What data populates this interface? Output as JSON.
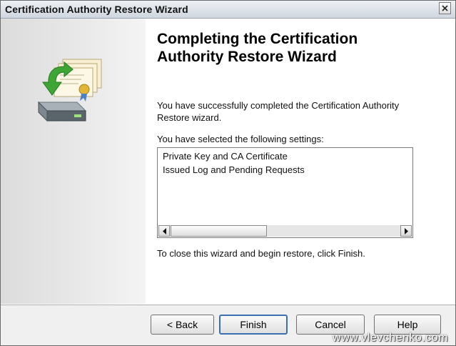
{
  "window": {
    "title": "Certification Authority Restore Wizard"
  },
  "main": {
    "heading_line1": "Completing the Certification",
    "heading_line2": "Authority Restore Wizard",
    "paragraph1": "You have successfully completed the Certification Authority Restore wizard.",
    "settings_label": "You have selected the following settings:",
    "settings": [
      "Private Key and CA Certificate",
      "Issued Log and Pending Requests"
    ],
    "instruction": "To close this wizard and begin restore, click Finish."
  },
  "buttons": {
    "back": "< Back",
    "finish": "Finish",
    "cancel": "Cancel",
    "help": "Help"
  },
  "watermark": "www.vlevchenko.com",
  "icons": [
    "close-icon",
    "certificate-restore-icon",
    "scroll-left-icon",
    "scroll-right-icon"
  ]
}
